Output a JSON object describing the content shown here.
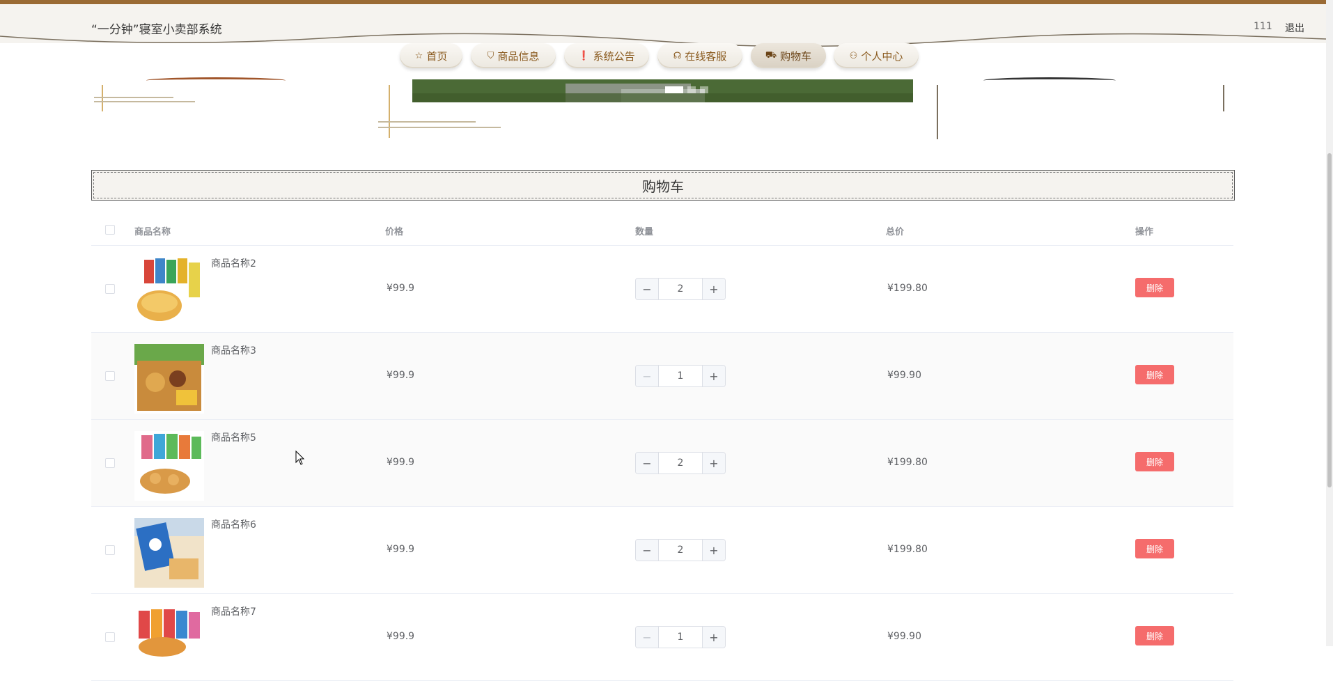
{
  "header": {
    "site_title": "“一分钟”寝室小卖部系统",
    "username": "111",
    "logout_label": "退出"
  },
  "nav": {
    "items": [
      {
        "label": "首页",
        "icon": "star-icon",
        "glyph": "☆"
      },
      {
        "label": "商品信息",
        "icon": "shopping-bag-icon",
        "glyph": "⛉"
      },
      {
        "label": "系统公告",
        "icon": "warning-circle-icon",
        "glyph": "❗"
      },
      {
        "label": "在线客服",
        "icon": "headset-icon",
        "glyph": "☊"
      },
      {
        "label": "购物车",
        "icon": "cart-icon",
        "glyph": "⛟"
      },
      {
        "label": "个人中心",
        "icon": "user-icon",
        "glyph": "⚇"
      }
    ],
    "active_index": 4
  },
  "section": {
    "title": "购物车"
  },
  "table": {
    "headers": {
      "name": "商品名称",
      "price": "价格",
      "quantity": "数量",
      "total": "总价",
      "action": "操作"
    },
    "rows": [
      {
        "name": "商品名称2",
        "price": "¥99.9",
        "quantity": "2",
        "total": "¥199.80",
        "action": "删除",
        "minus_disabled": false
      },
      {
        "name": "商品名称3",
        "price": "¥99.9",
        "quantity": "1",
        "total": "¥99.90",
        "action": "删除",
        "minus_disabled": true
      },
      {
        "name": "商品名称5",
        "price": "¥99.9",
        "quantity": "2",
        "total": "¥199.80",
        "action": "删除",
        "minus_disabled": false
      },
      {
        "name": "商品名称6",
        "price": "¥99.9",
        "quantity": "2",
        "total": "¥199.80",
        "action": "删除",
        "minus_disabled": false
      },
      {
        "name": "商品名称7",
        "price": "¥99.9",
        "quantity": "1",
        "total": "¥99.90",
        "action": "删除",
        "minus_disabled": true
      }
    ]
  },
  "stepper": {
    "minus_glyph": "−",
    "plus_glyph": "+"
  },
  "colors": {
    "accent": "#9a6a34",
    "danger": "#f56c6c",
    "nav_text": "#8a5a1e"
  }
}
